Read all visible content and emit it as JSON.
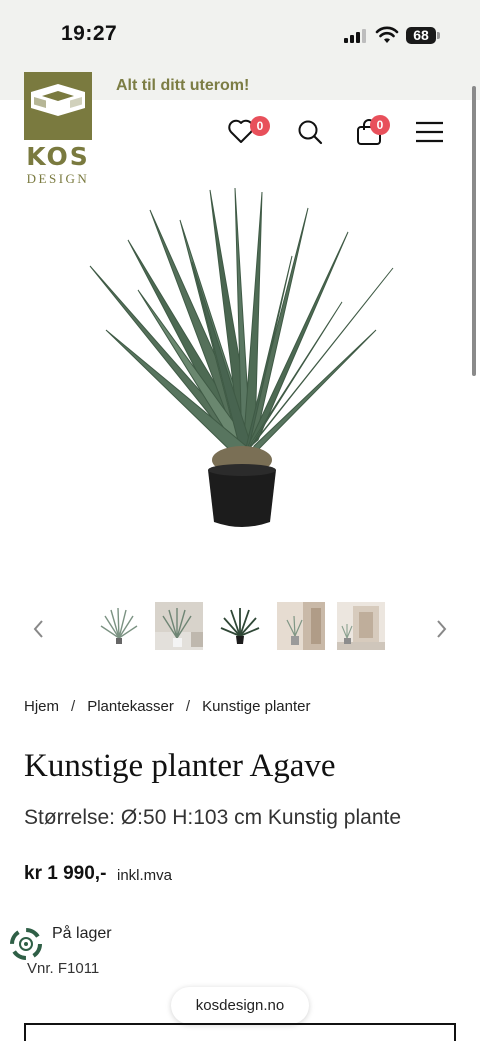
{
  "status": {
    "time": "19:27",
    "battery": "68"
  },
  "announcement": "Alt til ditt uterom!",
  "logo": {
    "word": "KOS",
    "sub": "DESIGN"
  },
  "header": {
    "wishlist_count": "0",
    "cart_count": "0"
  },
  "icons": [
    "heart-icon",
    "search-icon",
    "bag-icon",
    "menu-icon",
    "chevron-left-icon",
    "chevron-right-icon"
  ],
  "breadcrumb": [
    "Hjem",
    "Plantekasser",
    "Kunstige planter"
  ],
  "product": {
    "title": "Kunstige planter Agave",
    "subtitle": "Størrelse: Ø:50 H:103 cm Kunstig plante",
    "price": "kr 1 990,-",
    "price_note": "inkl.mva",
    "stock": "På lager",
    "sku": "Vnr. F1011"
  },
  "browser": {
    "url": "kosdesign.no"
  },
  "colors": {
    "brand_olive": "#7a7a3f",
    "badge": "#e8505b",
    "status_bg": "#f1f2ef"
  }
}
